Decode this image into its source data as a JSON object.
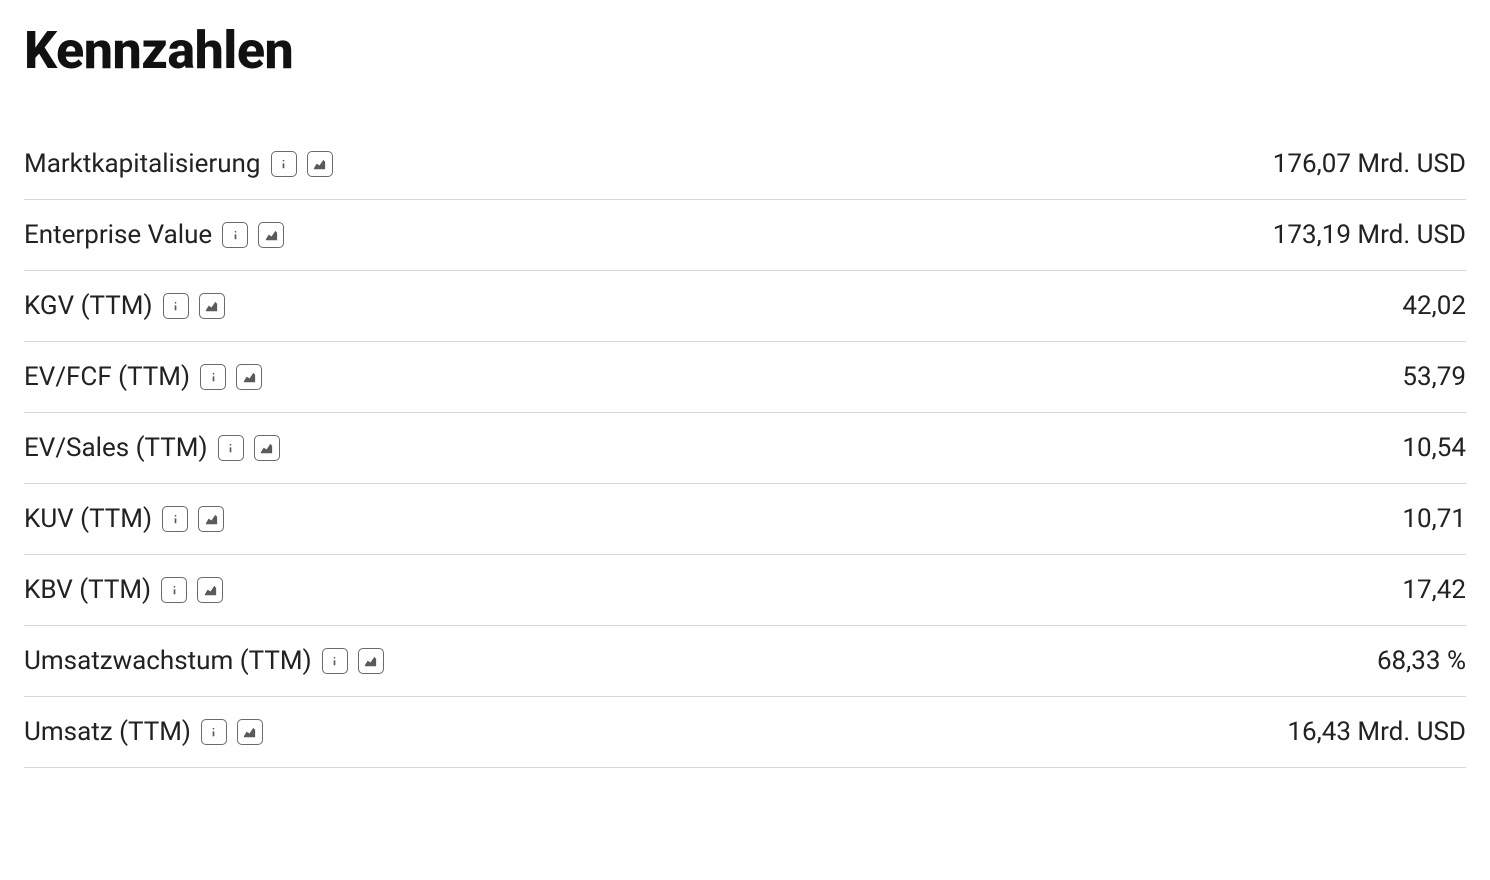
{
  "title": "Kennzahlen",
  "metrics": [
    {
      "label": "Marktkapitalisierung",
      "value": "176,07 Mrd. USD"
    },
    {
      "label": "Enterprise Value",
      "value": "173,19 Mrd. USD"
    },
    {
      "label": "KGV (TTM)",
      "value": "42,02"
    },
    {
      "label": "EV/FCF (TTM)",
      "value": "53,79"
    },
    {
      "label": "EV/Sales (TTM)",
      "value": "10,54"
    },
    {
      "label": "KUV (TTM)",
      "value": "10,71"
    },
    {
      "label": "KBV (TTM)",
      "value": "17,42"
    },
    {
      "label": "Umsatzwachstum (TTM)",
      "value": "68,33 %"
    },
    {
      "label": "Umsatz (TTM)",
      "value": "16,43 Mrd. USD"
    }
  ]
}
